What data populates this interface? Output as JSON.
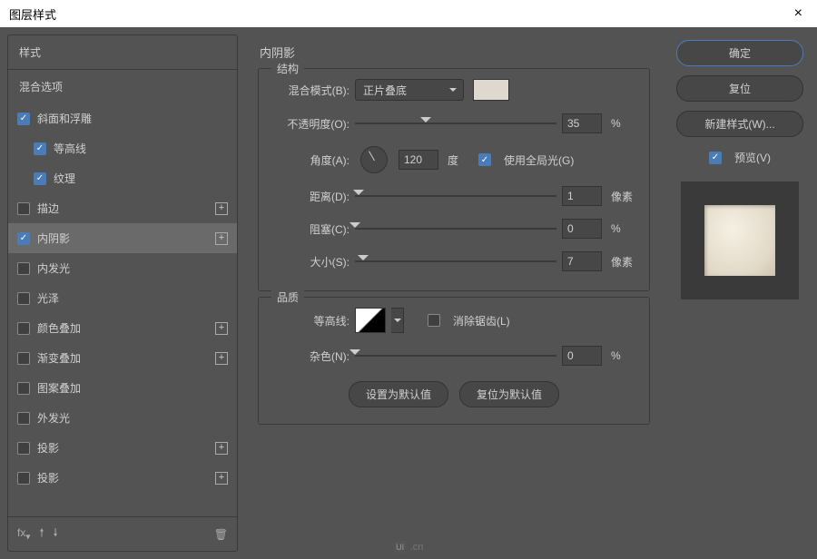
{
  "titlebar": {
    "title": "图层样式"
  },
  "sidebar": {
    "styles_header": "样式",
    "blend_header": "混合选项",
    "items": [
      {
        "label": "斜面和浮雕",
        "checked": true,
        "indent": false,
        "add": false
      },
      {
        "label": "等高线",
        "checked": true,
        "indent": true,
        "add": false
      },
      {
        "label": "纹理",
        "checked": true,
        "indent": true,
        "add": false
      },
      {
        "label": "描边",
        "checked": false,
        "indent": false,
        "add": true
      },
      {
        "label": "内阴影",
        "checked": true,
        "indent": false,
        "add": true,
        "selected": true
      },
      {
        "label": "内发光",
        "checked": false,
        "indent": false,
        "add": false
      },
      {
        "label": "光泽",
        "checked": false,
        "indent": false,
        "add": false
      },
      {
        "label": "颜色叠加",
        "checked": false,
        "indent": false,
        "add": true
      },
      {
        "label": "渐变叠加",
        "checked": false,
        "indent": false,
        "add": true
      },
      {
        "label": "图案叠加",
        "checked": false,
        "indent": false,
        "add": false
      },
      {
        "label": "外发光",
        "checked": false,
        "indent": false,
        "add": false
      },
      {
        "label": "投影",
        "checked": false,
        "indent": false,
        "add": true
      },
      {
        "label": "投影",
        "checked": false,
        "indent": false,
        "add": true
      }
    ],
    "fx_label": "fx"
  },
  "main": {
    "title": "内阴影",
    "group_structure": "结构",
    "group_quality": "品质",
    "blend_mode_label": "混合模式(B):",
    "blend_mode_value": "正片叠底",
    "color_swatch": "#ded8cf",
    "opacity_label": "不透明度(O):",
    "opacity_value": "35",
    "opacity_unit": "%",
    "angle_label": "角度(A):",
    "angle_value": "120",
    "angle_unit": "度",
    "global_light_label": "使用全局光(G)",
    "global_light_checked": true,
    "distance_label": "距离(D):",
    "distance_value": "1",
    "distance_unit": "像素",
    "choke_label": "阻塞(C):",
    "choke_value": "0",
    "choke_unit": "%",
    "size_label": "大小(S):",
    "size_value": "7",
    "size_unit": "像素",
    "contour_label": "等高线:",
    "antialias_label": "消除锯齿(L)",
    "antialias_checked": false,
    "noise_label": "杂色(N):",
    "noise_value": "0",
    "noise_unit": "%",
    "set_default": "设置为默认值",
    "reset_default": "复位为默认值"
  },
  "right": {
    "ok": "确定",
    "reset": "复位",
    "new_style": "新建样式(W)...",
    "preview_label": "预览(V)",
    "preview_checked": true
  },
  "watermark": {
    "logo": "UI",
    "text": ".cn"
  }
}
